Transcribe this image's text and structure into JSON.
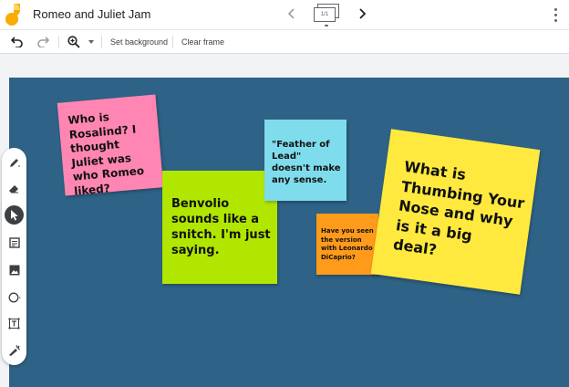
{
  "window": {
    "title": "Romeo and Juliet Jam"
  },
  "frame_nav": {
    "indicator": "1/1"
  },
  "toolbar": {
    "set_background": "Set background",
    "clear_frame": "Clear frame"
  },
  "colors": {
    "canvas": "#2e6286",
    "note_pink": "#ff86b3",
    "note_green": "#b0e600",
    "note_cyan": "#7fdcec",
    "note_orange": "#ff9a1a",
    "note_yellow": "#ffe93f"
  },
  "tools": [
    "pen-icon",
    "eraser-icon",
    "select-arrow-icon",
    "sticky-note-icon",
    "image-icon",
    "circle-shape-icon",
    "text-box-icon",
    "laser-icon"
  ],
  "notes": {
    "rosalind": "Who is Rosalind? I thought Juliet was who Romeo liked?",
    "benvolio": "Benvolio sounds like a snitch. I'm just saying.",
    "feather": "\"Feather of Lead\" doesn't make any sense.",
    "dicaprio": "Have you seen the version with Leonardo DiCaprio?",
    "thumbing": "What is Thumbing Your Nose and why is it a big deal?"
  }
}
